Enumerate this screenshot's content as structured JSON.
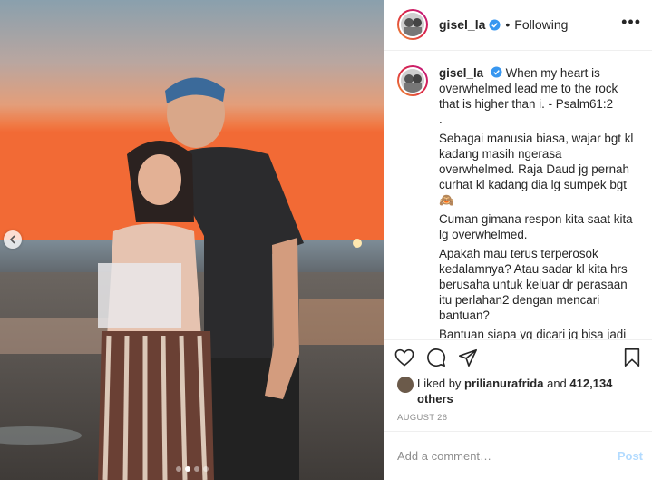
{
  "post": {
    "username": "gisel_la",
    "follow_state": "Following",
    "separator": "•",
    "more_label": "•••",
    "caption": [
      "When my heart is overwhelmed lead me to the rock that is higher than i. - Psalm61:2",
      ".",
      "Sebagai manusia biasa, wajar bgt kl kadang masih ngerasa overwhelmed. Raja Daud jg pernah curhat kl kadang dia lg sumpek bgt 🙈",
      "Cuman gimana respon kita saat kita lg overwhelmed.",
      "Apakah mau terus terperosok kedalamnya? Atau sadar kl kita hrs berusaha untuk keluar dr perasaan itu perlahan2 dengan mencari bantuan?",
      "Bantuan siapa yg dicari jg bisa jadi sangat menentukan langkah apa yg kita ambil setelah itu."
    ],
    "likes_prefix": "Liked by",
    "liked_by_user": "prilianurafrida",
    "likes_and": "and",
    "likes_count": "412,134 others",
    "date": "AUGUST 26",
    "comment_placeholder": "Add a comment…",
    "post_button": "Post"
  },
  "carousel": {
    "slide_count": 4,
    "active_index": 1
  },
  "colors": {
    "verified": "#3897f0",
    "post_disabled": "#b3dbff",
    "muted": "#8e8e8e"
  },
  "icons": [
    "heart-icon",
    "comment-icon",
    "share-icon",
    "bookmark-icon",
    "chevron-left-icon",
    "verified-badge-icon"
  ]
}
